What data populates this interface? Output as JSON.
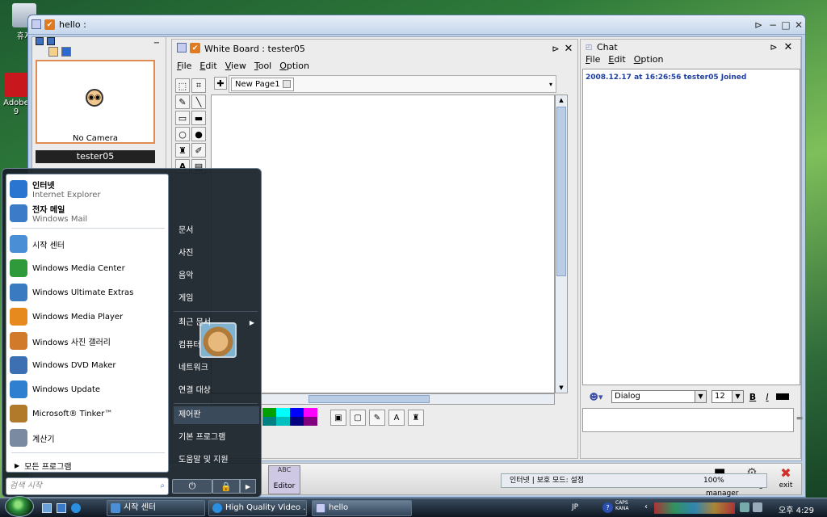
{
  "desktop": {
    "icons": [
      {
        "label": "휴지",
        "icon": "recycle-bin-icon"
      },
      {
        "label": "Adobe",
        "icon": "adobe-reader-icon"
      },
      {
        "label": "9",
        "icon": "number-icon"
      }
    ]
  },
  "hello_window": {
    "title": "hello :",
    "controls": {
      "pin": "⊳",
      "min": "−",
      "max": "□",
      "close": "✕"
    }
  },
  "video_panel": {
    "camera_status": "No Camera",
    "user": "tester05"
  },
  "whiteboard": {
    "title": "White Board : tester05",
    "menu": [
      "File",
      "Edit",
      "View",
      "Tool",
      "Option"
    ],
    "page_tab": "New Page1",
    "palette_colors": [
      "#00a000",
      "#00ffff",
      "#0000ff",
      "#ff00ff",
      "#008080",
      "#00c0c0",
      "#000080",
      "#800080"
    ]
  },
  "chat": {
    "title": "Chat",
    "menu": [
      "File",
      "Edit",
      "Option"
    ],
    "messages": [
      "2008.12.17 at 16:26:56 tester05 Joined"
    ],
    "font_name": "Dialog",
    "font_size": "12",
    "bold_label": "B",
    "italic_label": "I"
  },
  "bottom_bar": {
    "editor_label": "Editor",
    "task_manager_label": "task manager",
    "settings_label": "settings",
    "exit_label": "exit"
  },
  "start_menu": {
    "pinned": [
      {
        "title": "인터넷",
        "subtitle": "Internet Explorer",
        "icon": "internet-explorer-icon",
        "color": "#2a75d0"
      },
      {
        "title": "전자 메일",
        "subtitle": "Windows Mail",
        "icon": "windows-mail-icon",
        "color": "#3b7bc8"
      }
    ],
    "recent": [
      {
        "title": "시작 센터",
        "icon": "welcome-center-icon",
        "color": "#4a8fd6"
      },
      {
        "title": "Windows Media Center",
        "icon": "media-center-icon",
        "color": "#2e9a3a"
      },
      {
        "title": "Windows Ultimate Extras",
        "icon": "ultimate-extras-icon",
        "color": "#3a7ac0"
      },
      {
        "title": "Windows Media Player",
        "icon": "media-player-icon",
        "color": "#e68a1e"
      },
      {
        "title": "Windows 사진 갤러리",
        "icon": "photo-gallery-icon",
        "color": "#d07a2a"
      },
      {
        "title": "Windows DVD Maker",
        "icon": "dvd-maker-icon",
        "color": "#3d6fb3"
      },
      {
        "title": "Windows Update",
        "icon": "windows-update-icon",
        "color": "#2f7fd0"
      },
      {
        "title": "Microsoft® Tinker™",
        "icon": "tinker-icon",
        "color": "#b07a2a"
      },
      {
        "title": "계산기",
        "icon": "calculator-icon",
        "color": "#7a8aa0"
      }
    ],
    "all_programs": "모든 프로그램",
    "search_placeholder": "검색 시작",
    "right_items": [
      "문서",
      "사진",
      "음악",
      "게임",
      "최근 문서",
      "컴퓨터",
      "네트워크",
      "연결 대상",
      "제어판",
      "기본 프로그램",
      "도움말 및 지원"
    ]
  },
  "taskbar": {
    "tasks": [
      "시작 센터",
      "High Quality Video ...",
      "hello"
    ],
    "behind_text": "인터넷 | 보호 모드: 설정",
    "zoom": "100%",
    "tray_lang": "JP",
    "tray_caps": "CAPS",
    "tray_kana": "KANA",
    "clock": "오후 4:29"
  }
}
